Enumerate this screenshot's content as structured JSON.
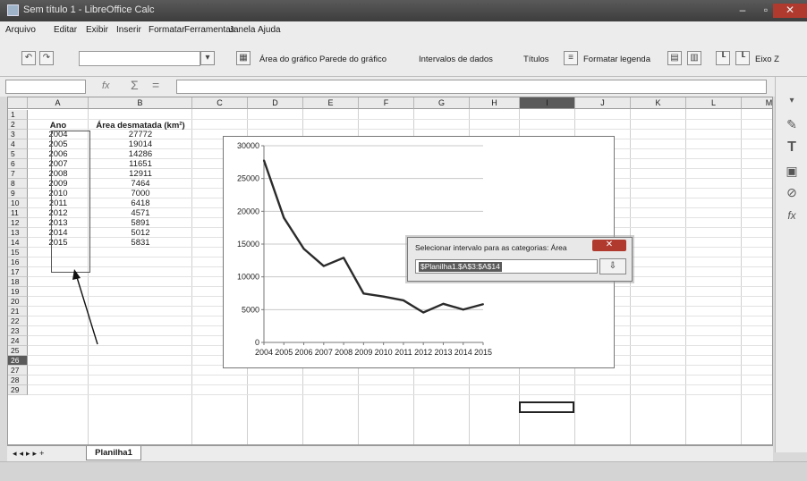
{
  "window": {
    "title": "Sem título 1 - LibreOffice Calc"
  },
  "menu": [
    "Arquivo",
    "Editar",
    "Exibir",
    "Inserir",
    "Formatar",
    "Ferramentas",
    "Janela",
    "Ajuda"
  ],
  "toolbar": {
    "chart_area": "Área do gráfico",
    "chart_wall": "Parede do gráfico",
    "data_ranges": "Intervalos de dados",
    "titles": "Títulos",
    "format_legend": "Formatar legenda",
    "axis_z": "Eixo Z"
  },
  "formula": {
    "fx": "fx",
    "sum": "Σ",
    "equals": "="
  },
  "columns": [
    "A",
    "B",
    "C",
    "D",
    "E",
    "F",
    "G",
    "H",
    "I",
    "J",
    "K",
    "L",
    "M"
  ],
  "table": {
    "header_year": "Ano",
    "header_area": "Área desmatada (km²)",
    "rows": [
      [
        "2004",
        "27772"
      ],
      [
        "2005",
        "19014"
      ],
      [
        "2006",
        "14286"
      ],
      [
        "2007",
        "11651"
      ],
      [
        "2008",
        "12911"
      ],
      [
        "2009",
        "7464"
      ],
      [
        "2010",
        "7000"
      ],
      [
        "2011",
        "6418"
      ],
      [
        "2012",
        "4571"
      ],
      [
        "2013",
        "5891"
      ],
      [
        "2014",
        "5012"
      ],
      [
        "2015",
        "5831"
      ]
    ]
  },
  "row_numbers": [
    "1",
    "2",
    "3",
    "4",
    "5",
    "6",
    "7",
    "8",
    "9",
    "10",
    "11",
    "12",
    "13",
    "14",
    "15",
    "16",
    "17",
    "18",
    "19",
    "20",
    "21",
    "22",
    "23",
    "24",
    "25",
    "26",
    "27",
    "28",
    "29"
  ],
  "chart_data": {
    "type": "line",
    "x": [
      "2004",
      "2005",
      "2006",
      "2007",
      "2008",
      "2009",
      "2010",
      "2011",
      "2012",
      "2013",
      "2014",
      "2015"
    ],
    "series": [
      {
        "values": [
          27772,
          19014,
          14286,
          11651,
          12911,
          7464,
          7000,
          6418,
          4571,
          5891,
          5012,
          5831
        ]
      }
    ],
    "ylim": [
      0,
      30000
    ],
    "yticks": [
      "0",
      "5000",
      "10000",
      "15000",
      "20000",
      "25000",
      "30000"
    ],
    "grid": true,
    "line_color": "#2b2b2b"
  },
  "dialog": {
    "title": "Selecionar intervalo para as categorias: Área",
    "close": "✕",
    "value": "$Planilha1.$A$3:$A$14"
  },
  "sheet_tab": "Planilha1",
  "colors": {
    "titlebar": "#4a4a4a",
    "close": "#b03a2e",
    "selection": "#5a5a5a"
  }
}
